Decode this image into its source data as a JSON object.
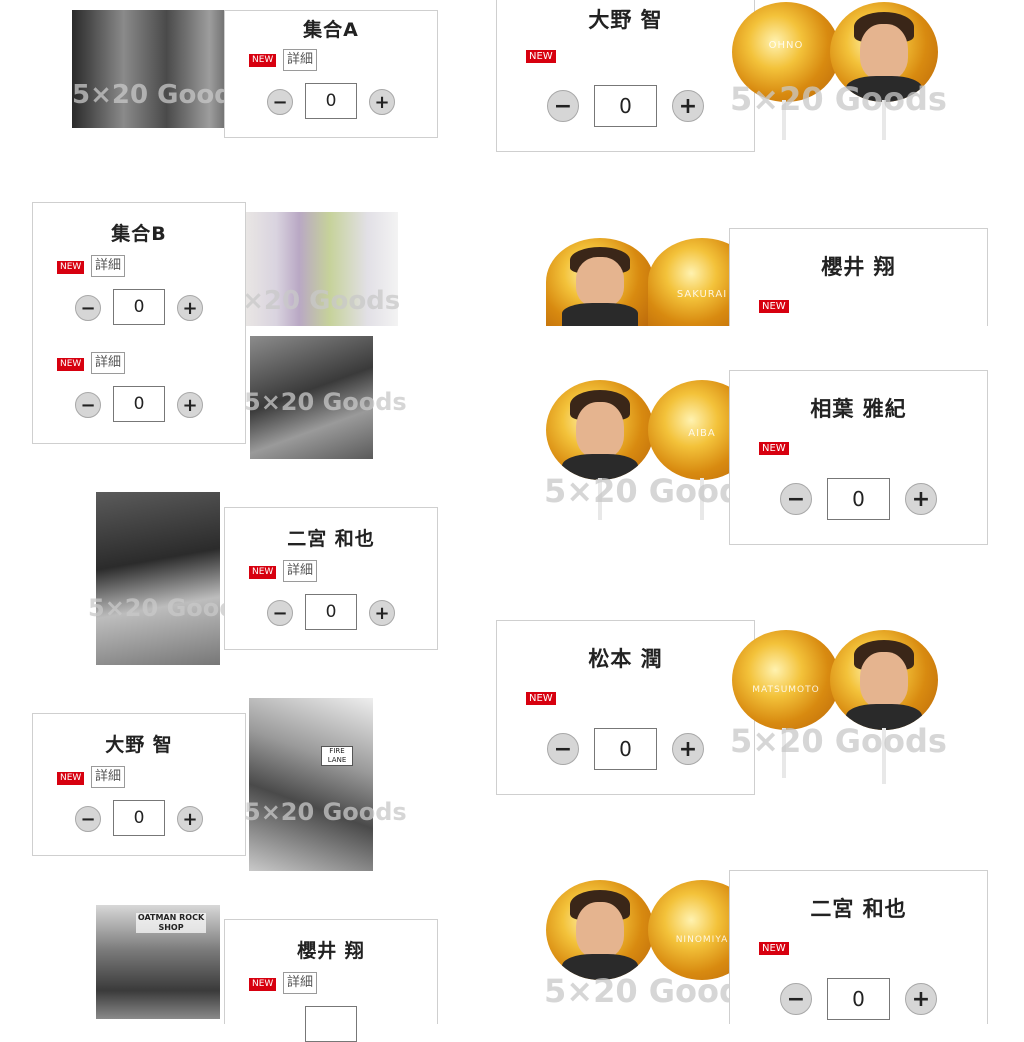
{
  "badge_label": "NEW",
  "detail_label": "詳細",
  "minus_label": "−",
  "plus_label": "+",
  "watermark": "5×20 Goods",
  "left_items": [
    {
      "name": "集合A",
      "qty": "0"
    },
    {
      "name": "集合B",
      "qty": "0"
    },
    {
      "name": "",
      "qty": "0"
    },
    {
      "name": "二宮 和也",
      "qty": "0"
    },
    {
      "name": "大野 智",
      "qty": "0"
    },
    {
      "name": "櫻井 翔",
      "qty": ""
    }
  ],
  "right_items": [
    {
      "name": "大野 智",
      "qty": "0",
      "fan_text": "OHNO"
    },
    {
      "name": "櫻井 翔",
      "qty": "",
      "fan_text": "SAKURAI"
    },
    {
      "name": "相葉 雅紀",
      "qty": "0",
      "fan_text": "AIBA"
    },
    {
      "name": "松本 潤",
      "qty": "0",
      "fan_text": "MATSUMOTO"
    },
    {
      "name": "二宮 和也",
      "qty": "0",
      "fan_text": "NINOMIYA"
    }
  ],
  "photo_signs": {
    "fire_lane": "FIRE LANE",
    "shop_sign": "OATMAN ROCK SHOP"
  }
}
